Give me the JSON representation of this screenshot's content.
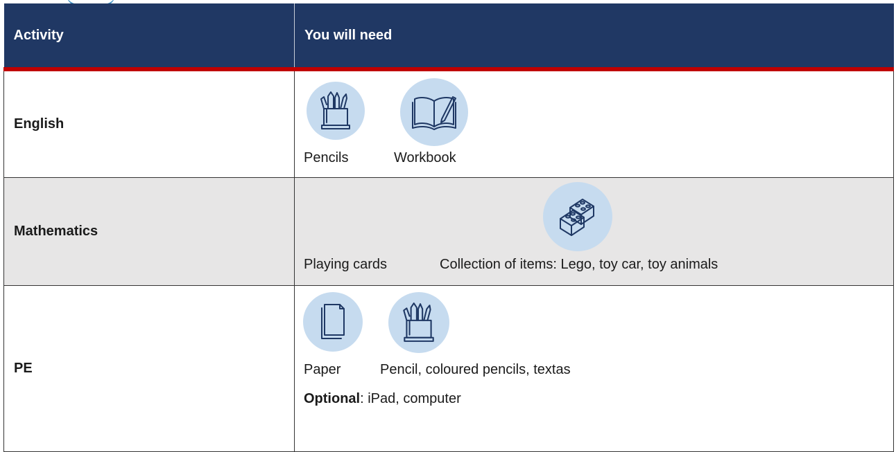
{
  "header": {
    "activity_label": "Activity",
    "need_label": "You will need"
  },
  "rows": [
    {
      "activity": "English",
      "items": [
        {
          "label": "Pencils",
          "icon": "pencil-cup-icon"
        },
        {
          "label": "Workbook",
          "icon": "open-book-icon"
        }
      ]
    },
    {
      "activity": "Mathematics",
      "items": [
        {
          "label": "Playing cards",
          "icon": ""
        },
        {
          "label": "Collection of items: Lego, toy car, toy animals",
          "icon": "lego-blocks-icon"
        }
      ]
    },
    {
      "activity": "PE",
      "items": [
        {
          "label": "Paper",
          "icon": "paper-icon"
        },
        {
          "label": "Pencil, coloured pencils, textas",
          "icon": "pencil-cup-icon"
        }
      ],
      "optional_label": "Optional",
      "optional_text": ": iPad, computer"
    }
  ],
  "colors": {
    "header_bg": "#203864",
    "header_rule": "#c00000",
    "icon_bg": "#c6dbef",
    "icon_stroke": "#1f3864",
    "shaded_row": "#e7e6e6"
  }
}
